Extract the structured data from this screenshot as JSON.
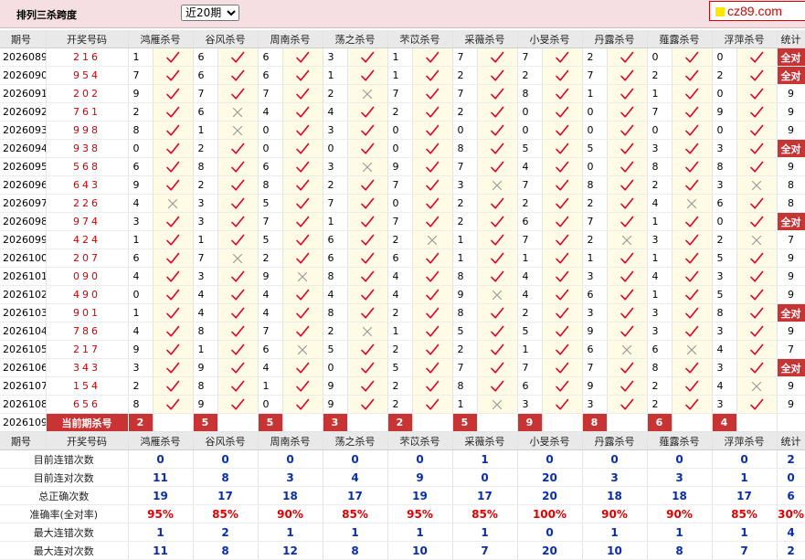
{
  "header": {
    "title": "排列三杀跨度",
    "period_select": {
      "selected": "近20期",
      "options": [
        "近20期"
      ]
    },
    "logo_text": "cz89.com"
  },
  "columns": {
    "period": "期号",
    "numbers": "开奖号码",
    "experts": [
      "鸿雁杀号",
      "谷风杀号",
      "周南杀号",
      "荡之杀号",
      "芣苡杀号",
      "采薇杀号",
      "小旻杀号",
      "丹露杀号",
      "薤露杀号",
      "浮萍杀号"
    ],
    "stat": "统计"
  },
  "rows": [
    {
      "p": "2026089",
      "n": "216",
      "v": [
        1,
        6,
        6,
        3,
        1,
        7,
        7,
        2,
        0,
        0
      ],
      "r": [
        1,
        1,
        1,
        1,
        1,
        1,
        1,
        1,
        1,
        1
      ],
      "s": "全对"
    },
    {
      "p": "2026090",
      "n": "954",
      "v": [
        7,
        6,
        6,
        1,
        1,
        2,
        2,
        7,
        2,
        2
      ],
      "r": [
        1,
        1,
        1,
        1,
        1,
        1,
        1,
        1,
        1,
        1
      ],
      "s": "全对"
    },
    {
      "p": "2026091",
      "n": "202",
      "v": [
        9,
        7,
        7,
        2,
        7,
        7,
        8,
        1,
        1,
        0
      ],
      "r": [
        1,
        1,
        1,
        0,
        1,
        1,
        1,
        1,
        1,
        1
      ],
      "s": "9"
    },
    {
      "p": "2026092",
      "n": "761",
      "v": [
        2,
        6,
        4,
        4,
        2,
        2,
        0,
        0,
        7,
        9
      ],
      "r": [
        1,
        0,
        1,
        1,
        1,
        1,
        1,
        1,
        1,
        1
      ],
      "s": "9"
    },
    {
      "p": "2026093",
      "n": "998",
      "v": [
        8,
        1,
        0,
        3,
        0,
        0,
        0,
        0,
        0,
        0
      ],
      "r": [
        1,
        0,
        1,
        1,
        1,
        1,
        1,
        1,
        1,
        1
      ],
      "s": "9"
    },
    {
      "p": "2026094",
      "n": "938",
      "v": [
        0,
        2,
        0,
        0,
        0,
        8,
        5,
        5,
        3,
        3
      ],
      "r": [
        1,
        1,
        1,
        1,
        1,
        1,
        1,
        1,
        1,
        1
      ],
      "s": "全对"
    },
    {
      "p": "2026095",
      "n": "568",
      "v": [
        6,
        8,
        6,
        3,
        9,
        7,
        4,
        0,
        8,
        8
      ],
      "r": [
        1,
        1,
        1,
        0,
        1,
        1,
        1,
        1,
        1,
        1
      ],
      "s": "9"
    },
    {
      "p": "2026096",
      "n": "643",
      "v": [
        9,
        2,
        8,
        2,
        7,
        3,
        7,
        8,
        2,
        3
      ],
      "r": [
        1,
        1,
        1,
        1,
        1,
        0,
        1,
        1,
        1,
        0
      ],
      "s": "8"
    },
    {
      "p": "2026097",
      "n": "226",
      "v": [
        4,
        3,
        5,
        7,
        0,
        2,
        2,
        2,
        4,
        6
      ],
      "r": [
        0,
        1,
        1,
        1,
        1,
        1,
        1,
        1,
        0,
        1
      ],
      "s": "8"
    },
    {
      "p": "2026098",
      "n": "974",
      "v": [
        3,
        3,
        7,
        1,
        7,
        2,
        6,
        7,
        1,
        0
      ],
      "r": [
        1,
        1,
        1,
        1,
        1,
        1,
        1,
        1,
        1,
        1
      ],
      "s": "全对"
    },
    {
      "p": "2026099",
      "n": "424",
      "v": [
        1,
        1,
        5,
        6,
        2,
        1,
        7,
        2,
        3,
        2
      ],
      "r": [
        1,
        1,
        1,
        1,
        0,
        1,
        1,
        0,
        1,
        0
      ],
      "s": "7"
    },
    {
      "p": "2026100",
      "n": "207",
      "v": [
        6,
        7,
        2,
        6,
        6,
        1,
        1,
        1,
        1,
        5
      ],
      "r": [
        1,
        0,
        1,
        1,
        1,
        1,
        1,
        1,
        1,
        1
      ],
      "s": "9"
    },
    {
      "p": "2026101",
      "n": "090",
      "v": [
        4,
        3,
        9,
        8,
        4,
        8,
        4,
        3,
        4,
        3
      ],
      "r": [
        1,
        1,
        0,
        1,
        1,
        1,
        1,
        1,
        1,
        1
      ],
      "s": "9"
    },
    {
      "p": "2026102",
      "n": "490",
      "v": [
        0,
        4,
        4,
        4,
        4,
        9,
        4,
        6,
        1,
        5
      ],
      "r": [
        1,
        1,
        1,
        1,
        1,
        0,
        1,
        1,
        1,
        1
      ],
      "s": "9"
    },
    {
      "p": "2026103",
      "n": "901",
      "v": [
        1,
        4,
        4,
        8,
        2,
        8,
        2,
        3,
        3,
        8
      ],
      "r": [
        1,
        1,
        1,
        1,
        1,
        1,
        1,
        1,
        1,
        1
      ],
      "s": "全对"
    },
    {
      "p": "2026104",
      "n": "786",
      "v": [
        4,
        8,
        7,
        2,
        1,
        5,
        5,
        9,
        3,
        3
      ],
      "r": [
        1,
        1,
        1,
        0,
        1,
        1,
        1,
        1,
        1,
        1
      ],
      "s": "9"
    },
    {
      "p": "2026105",
      "n": "217",
      "v": [
        9,
        1,
        6,
        5,
        2,
        2,
        1,
        6,
        6,
        4
      ],
      "r": [
        1,
        1,
        0,
        1,
        1,
        1,
        1,
        0,
        0,
        1
      ],
      "s": "7"
    },
    {
      "p": "2026106",
      "n": "343",
      "v": [
        3,
        9,
        4,
        0,
        5,
        7,
        7,
        7,
        8,
        3
      ],
      "r": [
        1,
        1,
        1,
        1,
        1,
        1,
        1,
        1,
        1,
        1
      ],
      "s": "全对"
    },
    {
      "p": "2026107",
      "n": "154",
      "v": [
        2,
        8,
        1,
        9,
        2,
        8,
        6,
        9,
        2,
        4
      ],
      "r": [
        1,
        1,
        1,
        1,
        1,
        1,
        1,
        1,
        1,
        0
      ],
      "s": "9"
    },
    {
      "p": "2026108",
      "n": "656",
      "v": [
        8,
        9,
        0,
        9,
        2,
        1,
        3,
        3,
        2,
        3
      ],
      "r": [
        1,
        1,
        1,
        1,
        1,
        0,
        1,
        1,
        1,
        1
      ],
      "s": "9"
    }
  ],
  "current": {
    "p": "2026109",
    "label": "当前期杀号",
    "v": [
      "2",
      "5",
      "5",
      "3",
      "2",
      "5",
      "9",
      "8",
      "6",
      "4"
    ]
  },
  "summary": [
    {
      "label": "目前连错次数",
      "v": [
        "0",
        "0",
        "0",
        "0",
        "0",
        "1",
        "0",
        "0",
        "0",
        "0"
      ],
      "s": "2",
      "red": false
    },
    {
      "label": "目前连对次数",
      "v": [
        "11",
        "8",
        "3",
        "4",
        "9",
        "0",
        "20",
        "3",
        "3",
        "1"
      ],
      "s": "0",
      "red": false
    },
    {
      "label": "总正确次数",
      "v": [
        "19",
        "17",
        "18",
        "17",
        "19",
        "17",
        "20",
        "18",
        "18",
        "17"
      ],
      "s": "6",
      "red": false
    },
    {
      "label": "准确率(全对率)",
      "v": [
        "95%",
        "85%",
        "90%",
        "85%",
        "95%",
        "85%",
        "100%",
        "90%",
        "90%",
        "85%"
      ],
      "s": "30%",
      "red": true
    },
    {
      "label": "最大连错次数",
      "v": [
        "1",
        "2",
        "1",
        "1",
        "1",
        "1",
        "0",
        "1",
        "1",
        "1"
      ],
      "s": "4",
      "red": false
    },
    {
      "label": "最大连对次数",
      "v": [
        "11",
        "8",
        "12",
        "8",
        "10",
        "7",
        "20",
        "10",
        "8",
        "7"
      ],
      "s": "2",
      "red": false
    }
  ],
  "colors": {
    "check": "#e0002a",
    "cross": "#9a9a9a",
    "highlight": "#c83434",
    "number": "#d40000",
    "summary": "#0a2ea8"
  }
}
